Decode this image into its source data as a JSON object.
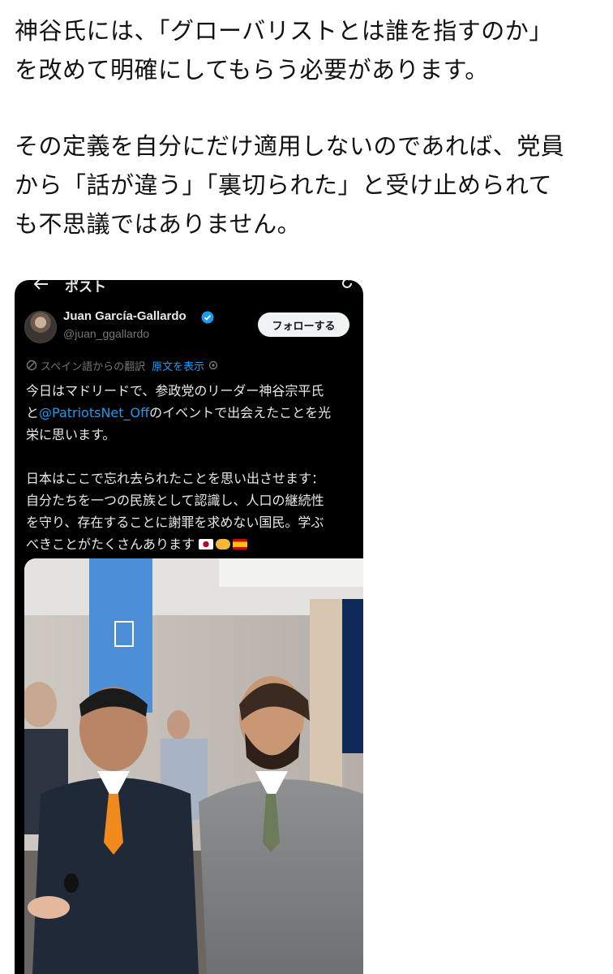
{
  "article": {
    "paragraph1": "神谷氏には、「グローバリストとは誰を指すのか」\nを改めて明確にしてもらう必要があります。",
    "paragraph2": "その定義を自分にだけ適用しないのであれば、党員\nから「話が違う」「裏切られた」と受け止められて\nも不思議ではありません。"
  },
  "embed": {
    "topbar_title": "ポスト",
    "author": {
      "name": "Juan García-Gallardo",
      "handle": "@juan_ggallardo"
    },
    "follow_label": "フォローする",
    "translation_note": "スペイン語からの翻訳",
    "show_original": "原文を表示",
    "tweet": {
      "line1_pre": "今日はマドリードで、参政党のリーダー神谷宗平氏",
      "line2_pre": "と",
      "mention": "@PatriotsNet_Off",
      "line2_post": "のイベントで出会えたことを光",
      "line3": "栄に思います。",
      "p2_line1": "日本はここで忘れ去られたことを思い出させます：",
      "p2_line2": "自分たちを一つの民族として認識し、人口の継続性",
      "p2_line3": "を守り、存在することに謝罪を求めない国民。学ぶ",
      "p2_line4": "べきことがたくさんあります"
    },
    "colors": {
      "background": "#000000",
      "link": "#1d9bf0",
      "verified": "#1d9bf0",
      "muted": "#71767b"
    }
  }
}
